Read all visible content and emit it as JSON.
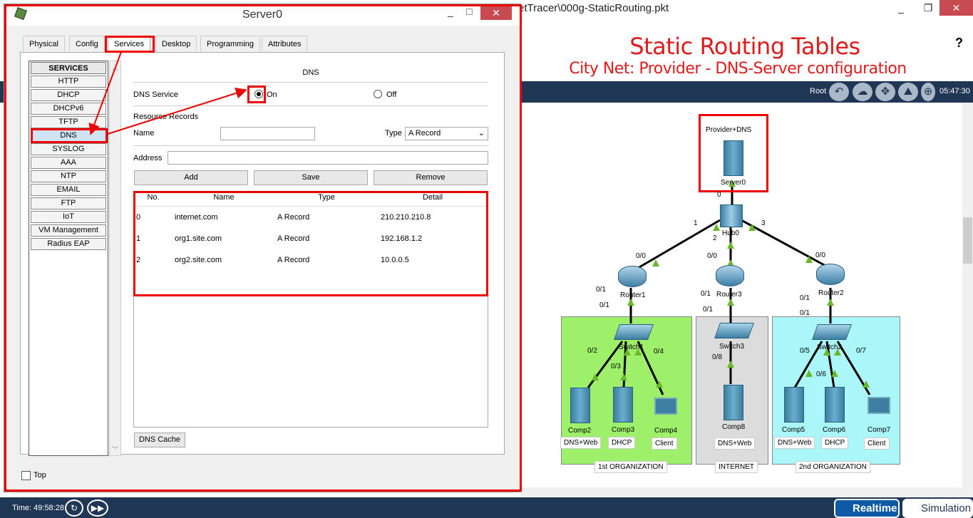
{
  "app": {
    "title_partial": "etTracer\\000g-StaticRouting.pkt",
    "help": "?",
    "heading": "Static Routing Tables",
    "subheading": "City Net: Provider - DNS-Server configuration",
    "root_label": "Root",
    "clock": "05:47:30",
    "time": "Time: 49:58:28",
    "realtime": "Realtime",
    "simulation": "Simulation"
  },
  "topology": {
    "devices": {
      "provider": "Provider+DNS",
      "server0": "Server0",
      "hub0": "Hub0",
      "router1": "Router1",
      "router2": "Router2",
      "router3": "Router3",
      "switch1": "Switch1",
      "switch2": "Switch2",
      "switch3": "Switch3",
      "comp2": "Comp2",
      "comp3": "Comp3",
      "comp4": "Comp4",
      "comp5": "Comp5",
      "comp6": "Comp6",
      "comp7": "Comp7",
      "comp8": "Comp8"
    },
    "tags": {
      "comp2": "DNS+Web",
      "comp3": "DHCP",
      "comp4": "Client",
      "comp5": "DNS+Web",
      "comp6": "DHCP",
      "comp7": "Client",
      "comp8": "DNS+Web"
    },
    "zones": {
      "org1": "1st ORGANIZATION",
      "internet": "INTERNET",
      "org2": "2nd ORGANIZATION"
    },
    "ports": {
      "hub_0": "0",
      "hub_1": "1",
      "hub_2": "2",
      "hub_3": "3",
      "r1_00": "0/0",
      "r1_01a": "0/1",
      "r1_01b": "0/1",
      "r3_00": "0/0",
      "r3_01a": "0/1",
      "r3_01b": "0/1",
      "r2_00": "0/0",
      "r2_01a": "0/1",
      "r2_01b": "0/1",
      "s1_02": "0/2",
      "s1_03": "0/3",
      "s1_04": "0/4",
      "s3_08": "0/8",
      "s2_05": "0/5",
      "s2_06": "0/6",
      "s2_07": "0/7"
    }
  },
  "dialog": {
    "title": "Server0",
    "tabs": [
      "Physical",
      "Config",
      "Services",
      "Desktop",
      "Programming",
      "Attributes"
    ],
    "services_header": "SERVICES",
    "services": [
      "HTTP",
      "DHCP",
      "DHCPv6",
      "TFTP",
      "DNS",
      "SYSLOG",
      "AAA",
      "NTP",
      "EMAIL",
      "FTP",
      "IoT",
      "VM Management",
      "Radius EAP"
    ],
    "dns": {
      "section_title": "DNS",
      "service_label": "DNS Service",
      "on_label": "On",
      "off_label": "Off",
      "resource_records": "Resource Records",
      "name_label": "Name",
      "name_value": "",
      "type_label": "Type",
      "type_value": "A Record",
      "address_label": "Address",
      "address_value": "",
      "add": "Add",
      "save": "Save",
      "remove": "Remove",
      "columns": [
        "No.",
        "Name",
        "Type",
        "Detail"
      ],
      "rows": [
        {
          "no": "0",
          "name": "internet.com",
          "type": "A Record",
          "detail": "210.210.210.8"
        },
        {
          "no": "1",
          "name": "org1.site.com",
          "type": "A Record",
          "detail": "192.168.1.2"
        },
        {
          "no": "2",
          "name": "org2.site.com",
          "type": "A Record",
          "detail": "10.0.0.5"
        }
      ],
      "cache_button": "DNS Cache"
    },
    "top_label": "Top"
  }
}
